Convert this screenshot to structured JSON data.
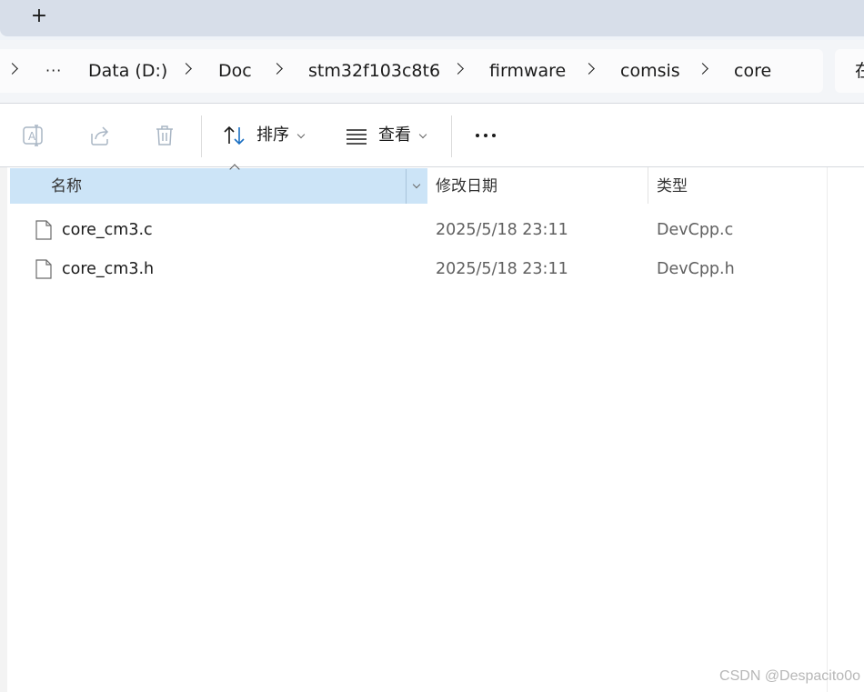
{
  "tabbar": {
    "new_tab_label": "+"
  },
  "breadcrumb": {
    "overflow_label": "···",
    "items": [
      "Data (D:)",
      "Doc",
      "stm32f103c8t6",
      "firmware",
      "comsis",
      "core"
    ]
  },
  "search": {
    "visible_text": "在"
  },
  "toolbar": {
    "sort_label": "排序",
    "view_label": "查看"
  },
  "list": {
    "columns": {
      "name": "名称",
      "date": "修改日期",
      "type": "类型"
    },
    "rows": [
      {
        "name": "core_cm3.c",
        "date": "2025/5/18 23:11",
        "type": "DevCpp.c"
      },
      {
        "name": "core_cm3.h",
        "date": "2025/5/18 23:11",
        "type": "DevCpp.h"
      }
    ]
  },
  "watermark": "CSDN @Despacito0o"
}
